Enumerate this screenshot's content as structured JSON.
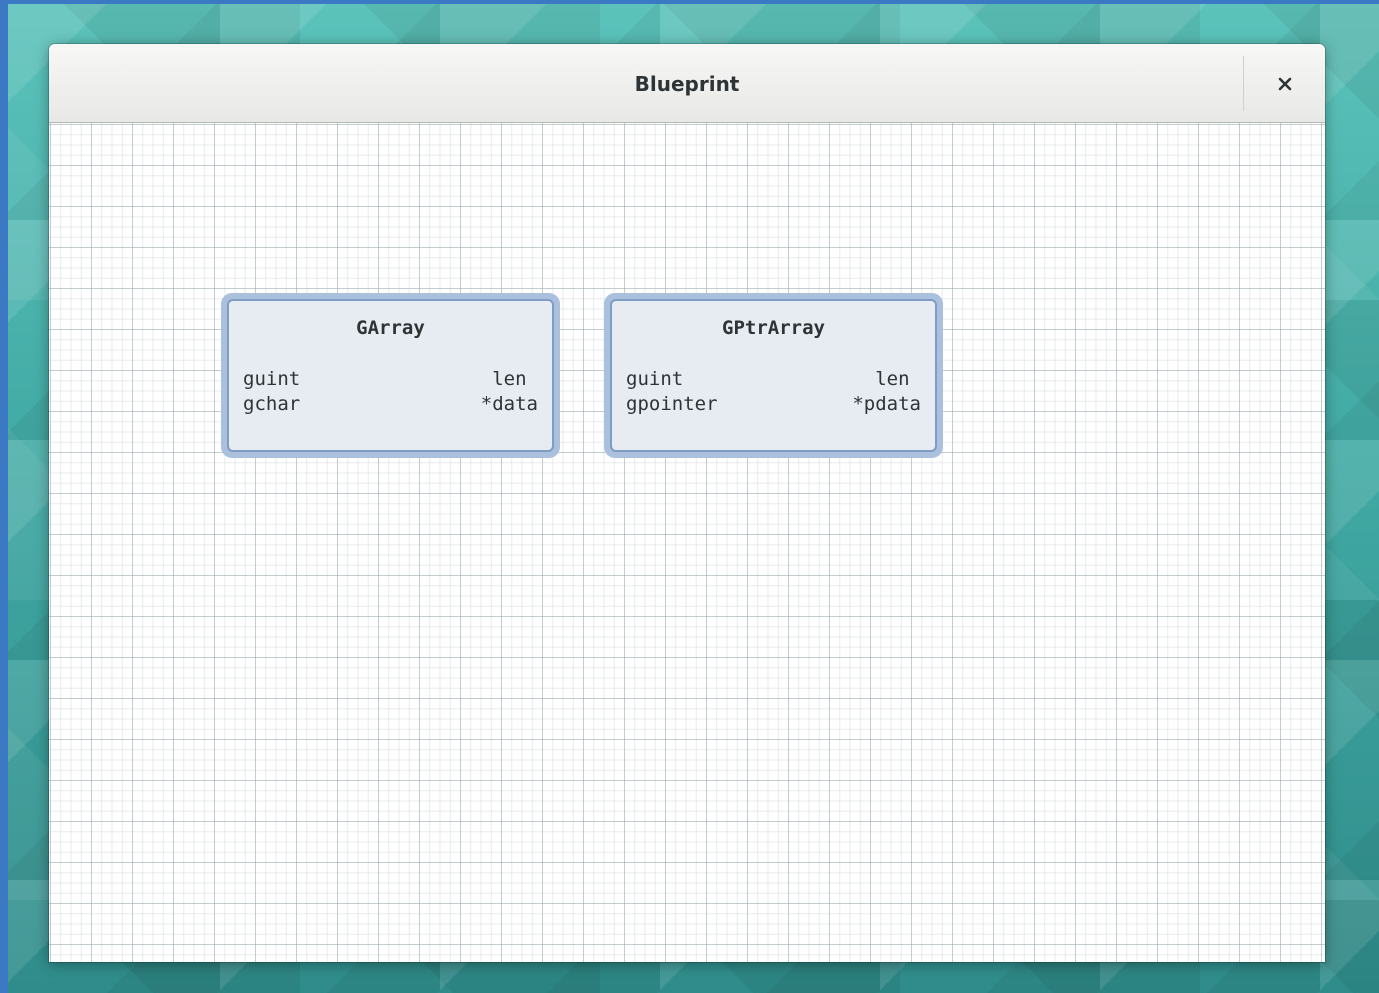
{
  "window": {
    "title": "Blueprint",
    "close_icon": "close-icon"
  },
  "structs": [
    {
      "name": "GArray",
      "fields": [
        {
          "type": "guint",
          "name": "len "
        },
        {
          "type": "gchar",
          "name": "*data"
        }
      ]
    },
    {
      "name": "GPtrArray",
      "fields": [
        {
          "type": "guint",
          "name": "len "
        },
        {
          "type": "gpointer",
          "name": "*pdata"
        }
      ]
    }
  ],
  "colors": {
    "struct_border": "#7f9cc4",
    "struct_halo": "#aac0dc",
    "struct_fill": "#e7ebf2",
    "desktop_accent": "#3e9f9a"
  }
}
